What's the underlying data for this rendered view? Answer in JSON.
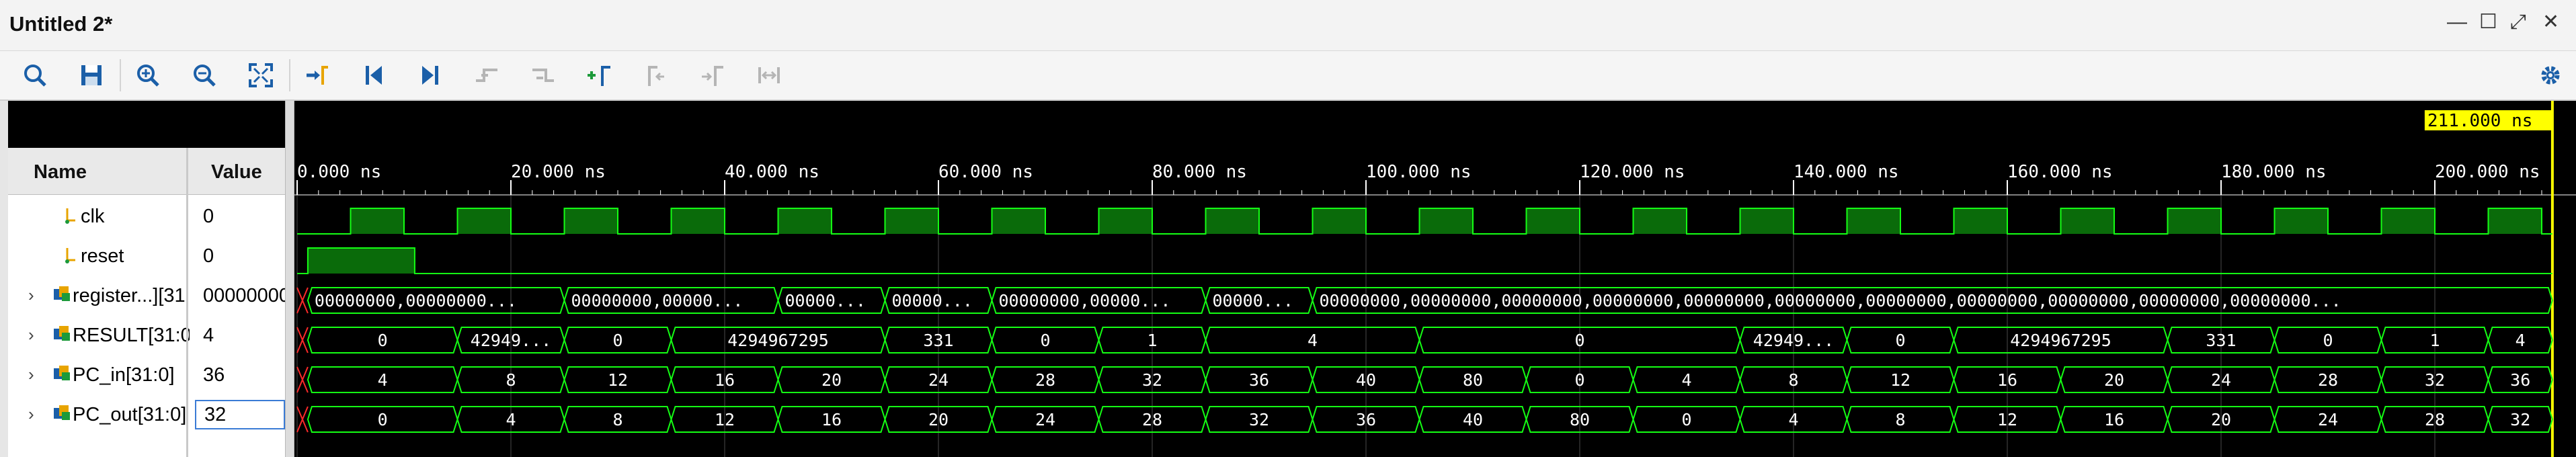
{
  "window": {
    "title": "Untitled 2*",
    "controls": [
      "minimize-icon",
      "restore-icon",
      "float-icon",
      "close-icon"
    ]
  },
  "toolbar": {
    "buttons": [
      {
        "name": "search",
        "icon": "search-icon"
      },
      {
        "name": "save",
        "icon": "save-icon"
      },
      {
        "name": "zoom-in",
        "icon": "zoom-in-icon"
      },
      {
        "name": "zoom-out",
        "icon": "zoom-out-icon"
      },
      {
        "name": "zoom-fit",
        "icon": "zoom-fit-icon"
      },
      {
        "name": "go-to-cursor",
        "icon": "go-to-cursor-icon"
      },
      {
        "name": "go-to-time-0",
        "icon": "first-icon"
      },
      {
        "name": "go-to-last-time",
        "icon": "last-icon"
      },
      {
        "name": "previous-transition",
        "icon": "prev-transition-icon"
      },
      {
        "name": "next-transition",
        "icon": "next-transition-icon"
      },
      {
        "name": "add-marker",
        "icon": "add-marker-icon"
      },
      {
        "name": "previous-marker",
        "icon": "prev-marker-icon"
      },
      {
        "name": "next-marker",
        "icon": "next-marker-icon"
      },
      {
        "name": "swap-cursors",
        "icon": "swap-cursors-icon"
      }
    ],
    "settings_icon": "gear-icon"
  },
  "columns": {
    "name": "Name",
    "value": "Value"
  },
  "cursor": {
    "label": "211.000 ns"
  },
  "timeline": {
    "ticks": [
      "0.000 ns",
      "20.000 ns",
      "40.000 ns",
      "60.000 ns",
      "80.000 ns",
      "100.000 ns",
      "120.000 ns",
      "140.000 ns",
      "160.000 ns",
      "180.000 ns",
      "200.000 ns"
    ]
  },
  "signals": [
    {
      "name": "clk",
      "value": "0",
      "type": "bit",
      "expandable": false
    },
    {
      "name": "reset",
      "value": "0",
      "type": "bit",
      "expandable": false
    },
    {
      "name": "register...][31",
      "value": "00000000,",
      "type": "bus",
      "expandable": true
    },
    {
      "name": "RESULT[31:0",
      "value": "4",
      "type": "bus",
      "expandable": true
    },
    {
      "name": "PC_in[31:0]",
      "value": "36",
      "type": "bus",
      "expandable": true
    },
    {
      "name": "PC_out[31:0]",
      "value": "32",
      "type": "bus",
      "expandable": true,
      "selected": true
    }
  ],
  "colors": {
    "wave_green": "#14ff14",
    "fill_green": "#0a6b0a",
    "cursor_yellow": "#ffff00",
    "ruler_text": "#ffffff",
    "background": "#000000"
  },
  "chart_data": {
    "type": "waveform",
    "time_unit": "ns",
    "time_range": [
      0,
      211
    ],
    "clk": {
      "period": 10,
      "first_rise": 5
    },
    "reset": {
      "high_from": 1,
      "high_to": 11
    },
    "register_segments": [
      {
        "start": 1,
        "end": 25,
        "label": "00000000,00000000..."
      },
      {
        "start": 25,
        "end": 45,
        "label": "00000000,00000..."
      },
      {
        "start": 45,
        "end": 55,
        "label": "00000..."
      },
      {
        "start": 55,
        "end": 65,
        "label": "00000..."
      },
      {
        "start": 65,
        "end": 85,
        "label": "00000000,00000..."
      },
      {
        "start": 85,
        "end": 95,
        "label": "00000..."
      },
      {
        "start": 95,
        "end": 211,
        "label": "00000000,00000000,00000000,00000000,00000000,00000000,00000000,00000000,00000000,00000000,00000000..."
      }
    ],
    "result_segments": [
      {
        "start": 1,
        "end": 15,
        "label": "0"
      },
      {
        "start": 15,
        "end": 25,
        "label": "42949..."
      },
      {
        "start": 25,
        "end": 35,
        "label": "0"
      },
      {
        "start": 35,
        "end": 55,
        "label": "4294967295"
      },
      {
        "start": 55,
        "end": 65,
        "label": "331"
      },
      {
        "start": 65,
        "end": 75,
        "label": "0"
      },
      {
        "start": 75,
        "end": 85,
        "label": "1"
      },
      {
        "start": 85,
        "end": 105,
        "label": "4"
      },
      {
        "start": 105,
        "end": 135,
        "label": "0"
      },
      {
        "start": 135,
        "end": 145,
        "label": "42949..."
      },
      {
        "start": 145,
        "end": 155,
        "label": "0"
      },
      {
        "start": 155,
        "end": 175,
        "label": "4294967295"
      },
      {
        "start": 175,
        "end": 185,
        "label": "331"
      },
      {
        "start": 185,
        "end": 195,
        "label": "0"
      },
      {
        "start": 195,
        "end": 205,
        "label": "1"
      },
      {
        "start": 205,
        "end": 211,
        "label": "4"
      }
    ],
    "pc_in_segments": [
      {
        "start": 1,
        "end": 15,
        "label": "4"
      },
      {
        "start": 15,
        "end": 25,
        "label": "8"
      },
      {
        "start": 25,
        "end": 35,
        "label": "12"
      },
      {
        "start": 35,
        "end": 45,
        "label": "16"
      },
      {
        "start": 45,
        "end": 55,
        "label": "20"
      },
      {
        "start": 55,
        "end": 65,
        "label": "24"
      },
      {
        "start": 65,
        "end": 75,
        "label": "28"
      },
      {
        "start": 75,
        "end": 85,
        "label": "32"
      },
      {
        "start": 85,
        "end": 95,
        "label": "36"
      },
      {
        "start": 95,
        "end": 105,
        "label": "40"
      },
      {
        "start": 105,
        "end": 115,
        "label": "80"
      },
      {
        "start": 115,
        "end": 125,
        "label": "0"
      },
      {
        "start": 125,
        "end": 135,
        "label": "4"
      },
      {
        "start": 135,
        "end": 145,
        "label": "8"
      },
      {
        "start": 145,
        "end": 155,
        "label": "12"
      },
      {
        "start": 155,
        "end": 165,
        "label": "16"
      },
      {
        "start": 165,
        "end": 175,
        "label": "20"
      },
      {
        "start": 175,
        "end": 185,
        "label": "24"
      },
      {
        "start": 185,
        "end": 195,
        "label": "28"
      },
      {
        "start": 195,
        "end": 205,
        "label": "32"
      },
      {
        "start": 205,
        "end": 211,
        "label": "36"
      }
    ],
    "pc_out_segments": [
      {
        "start": 1,
        "end": 15,
        "label": "0"
      },
      {
        "start": 15,
        "end": 25,
        "label": "4"
      },
      {
        "start": 25,
        "end": 35,
        "label": "8"
      },
      {
        "start": 35,
        "end": 45,
        "label": "12"
      },
      {
        "start": 45,
        "end": 55,
        "label": "16"
      },
      {
        "start": 55,
        "end": 65,
        "label": "20"
      },
      {
        "start": 65,
        "end": 75,
        "label": "24"
      },
      {
        "start": 75,
        "end": 85,
        "label": "28"
      },
      {
        "start": 85,
        "end": 95,
        "label": "32"
      },
      {
        "start": 95,
        "end": 105,
        "label": "36"
      },
      {
        "start": 105,
        "end": 115,
        "label": "40"
      },
      {
        "start": 115,
        "end": 125,
        "label": "80"
      },
      {
        "start": 125,
        "end": 135,
        "label": "0"
      },
      {
        "start": 135,
        "end": 145,
        "label": "4"
      },
      {
        "start": 145,
        "end": 155,
        "label": "8"
      },
      {
        "start": 155,
        "end": 165,
        "label": "12"
      },
      {
        "start": 165,
        "end": 175,
        "label": "16"
      },
      {
        "start": 175,
        "end": 185,
        "label": "20"
      },
      {
        "start": 185,
        "end": 195,
        "label": "24"
      },
      {
        "start": 195,
        "end": 205,
        "label": "28"
      },
      {
        "start": 205,
        "end": 211,
        "label": "32"
      }
    ]
  }
}
